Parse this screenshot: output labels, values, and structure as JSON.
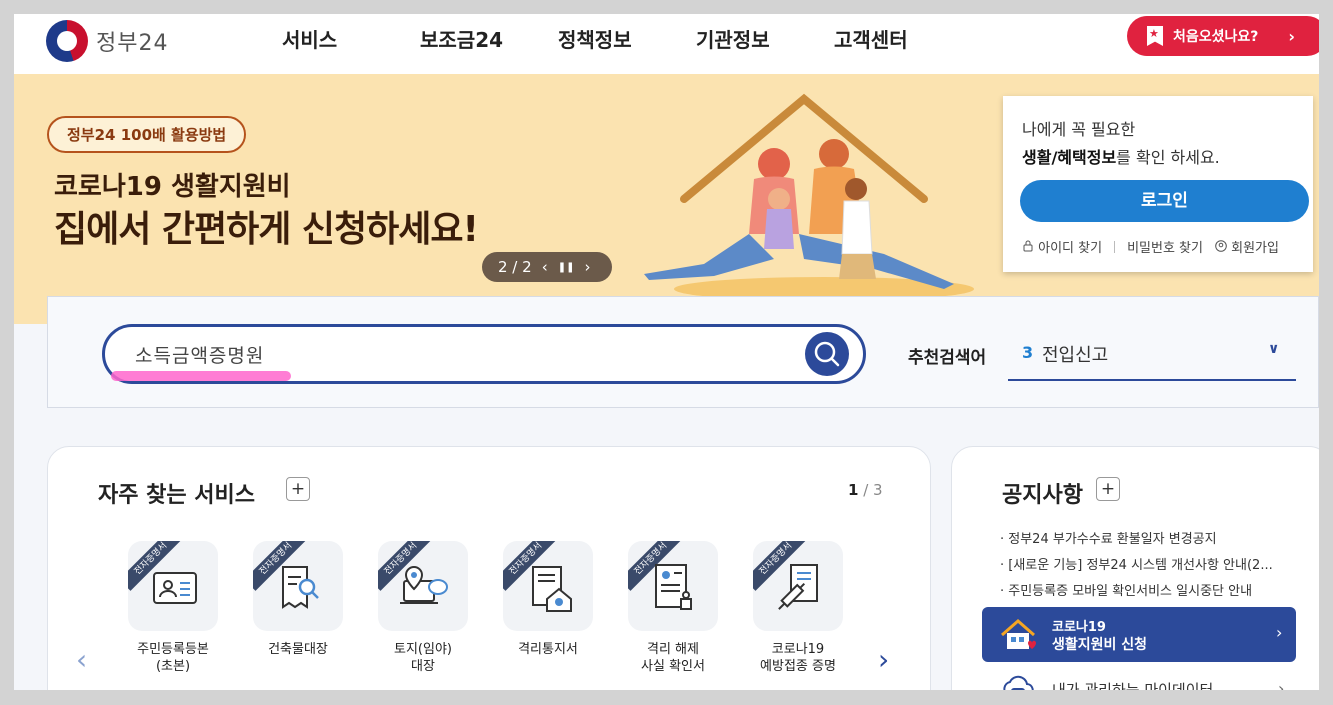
{
  "header": {
    "logo_text": "정부24",
    "nav": [
      "서비스",
      "보조금24",
      "정책정보",
      "기관정보",
      "고객센터"
    ],
    "first_visit_label": "처음오셨나요?"
  },
  "banner": {
    "pill": "정부24 100배 활용방법",
    "line1": "코로나19 생활지원비",
    "line2": "집에서 간편하게 신청하세요!",
    "slide_counter": "2 / 2"
  },
  "login": {
    "text1": "나에게 꼭 필요한",
    "text2_bold": "생활/혜택정보",
    "text2_rest": "를 확인 하세요.",
    "button": "로그인",
    "links": [
      "아이디 찾기",
      "비밀번호 찾기",
      "회원가입"
    ]
  },
  "search": {
    "value": "소득금액증명원",
    "rec_label": "추천검색어",
    "rec_number": "3",
    "rec_value": "전입신고"
  },
  "freq": {
    "title": "자주 찾는 서비스",
    "page_current": "1",
    "page_total": "/ 3",
    "tag": "전자증명서",
    "services": [
      {
        "label": "주민등록등본\n(초본)",
        "icon": "id-card-icon"
      },
      {
        "label": "건축물대장",
        "icon": "document-search-icon"
      },
      {
        "label": "토지(임야)\n대장",
        "icon": "map-pin-laptop-icon"
      },
      {
        "label": "격리통지서",
        "icon": "house-virus-icon"
      },
      {
        "label": "격리 해제\n사실 확인서",
        "icon": "document-stamp-icon"
      },
      {
        "label": "코로나19\n예방접종 증명",
        "icon": "syringe-icon"
      }
    ]
  },
  "notice": {
    "title": "공지사항",
    "items": [
      "정부24 부가수수료 환불일자 변경공지",
      "[새로운 기능] 정부24 시스템 개선사항 안내(2...",
      "주민등록증 모바일 확인서비스 일시중단 안내"
    ],
    "corona_t1": "코로나19",
    "corona_t2": "생활지원비 신청",
    "mydata": "내가 관리하는 마이데이터"
  },
  "colors": {
    "primary": "#2c4a9a",
    "accent_red": "#e0223f",
    "login_blue": "#1f7fd0",
    "banner_bg": "#fbe3b0"
  }
}
